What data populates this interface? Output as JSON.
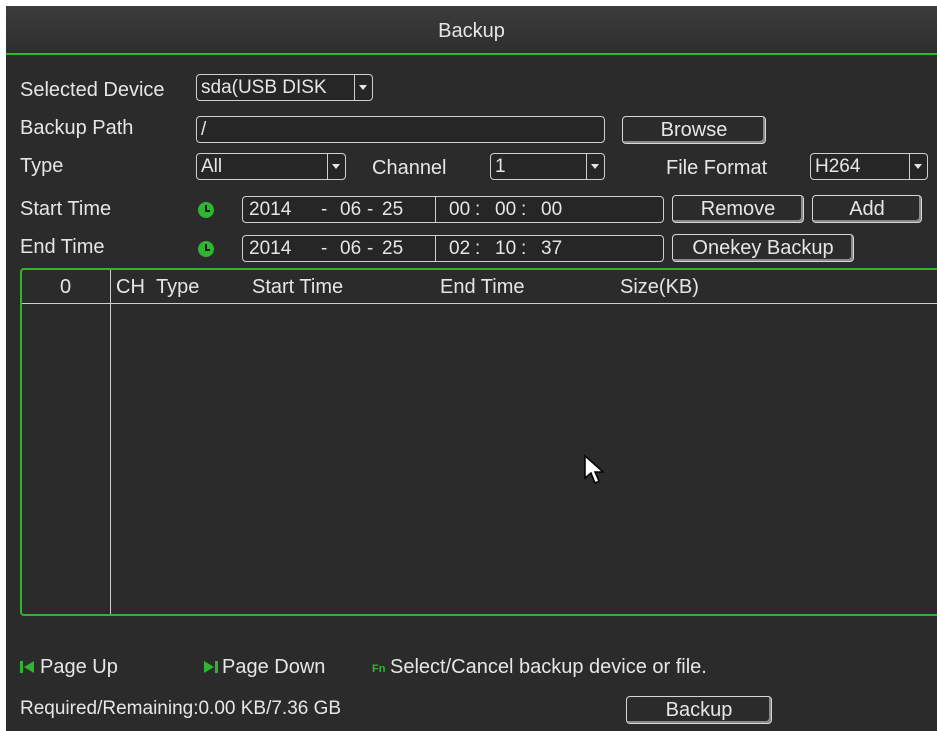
{
  "title": "Backup",
  "form": {
    "selected_device_label": "Selected Device",
    "selected_device_value": "sda(USB DISK",
    "backup_path_label": "Backup Path",
    "backup_path_value": "/",
    "browse_label": "Browse",
    "type_label": "Type",
    "type_value": "All",
    "channel_label": "Channel",
    "channel_value": "1",
    "file_format_label": "File Format",
    "file_format_value": "H264",
    "start_time_label": "Start Time",
    "start": {
      "year": "2014",
      "month": "06",
      "day": "25",
      "hour": "00",
      "minute": "00",
      "second": "00"
    },
    "end_time_label": "End Time",
    "end": {
      "year": "2014",
      "month": "06",
      "day": "25",
      "hour": "02",
      "minute": "10",
      "second": "37"
    },
    "remove_label": "Remove",
    "add_label": "Add",
    "onekey_label": "Onekey Backup"
  },
  "table": {
    "count": "0",
    "columns": [
      "CH",
      "Type",
      "Start Time",
      "End Time",
      "Size(KB)"
    ]
  },
  "footer": {
    "page_up": "Page Up",
    "page_down": "Page Down",
    "fn_badge": "Fn",
    "fn_hint": "Select/Cancel backup device or file.",
    "required_remaining": "Required/Remaining:0.00 KB/7.36 GB",
    "backup_label": "Backup"
  },
  "colors": {
    "accent": "#2fb52f",
    "background": "#2b2b2b",
    "text": "#e6e6e6"
  }
}
